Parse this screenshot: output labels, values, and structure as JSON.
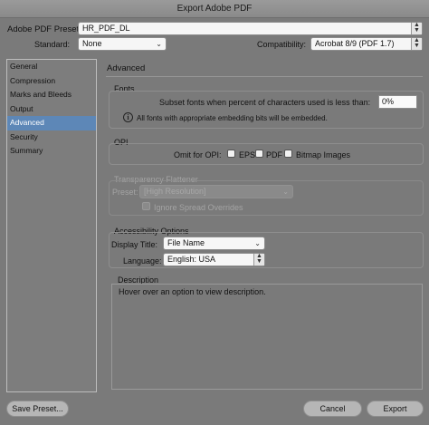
{
  "window": {
    "title": "Export Adobe PDF"
  },
  "header": {
    "preset_label": "Adobe PDF Preset:",
    "preset_value": "HR_PDF_DL",
    "standard_label": "Standard:",
    "standard_value": "None",
    "compat_label": "Compatibility:",
    "compat_value": "Acrobat 8/9 (PDF 1.7)"
  },
  "sidebar": {
    "items": [
      {
        "label": "General"
      },
      {
        "label": "Compression"
      },
      {
        "label": "Marks and Bleeds"
      },
      {
        "label": "Output"
      },
      {
        "label": "Advanced"
      },
      {
        "label": "Security"
      },
      {
        "label": "Summary"
      }
    ]
  },
  "main": {
    "section_title": "Advanced",
    "fonts": {
      "title": "Fonts",
      "subset_label": "Subset fonts when percent of characters used is less than:",
      "subset_value": "0%",
      "info_icon": "info-icon",
      "info_text": "All fonts with appropriate embedding bits will be embedded."
    },
    "opi": {
      "title": "OPI",
      "omit_label": "Omit for OPI:",
      "eps_label": "EPS",
      "pdf_label": "PDF",
      "bitmap_label": "Bitmap Images"
    },
    "transparency": {
      "title": "Transparency Flattener",
      "preset_label": "Preset:",
      "preset_value": "[High Resolution]",
      "ignore_label": "Ignore Spread Overrides"
    },
    "accessibility": {
      "title": "Accessibility Options",
      "display_title_label": "Display Title:",
      "display_title_value": "File Name",
      "language_label": "Language:",
      "language_value": "English: USA"
    },
    "description": {
      "title": "Description",
      "text": "Hover over an option to view description."
    }
  },
  "footer": {
    "save_preset": "Save Preset...",
    "cancel": "Cancel",
    "export": "Export"
  },
  "colors": {
    "selection": "#5d87b7",
    "background": "#7a7a7a"
  }
}
